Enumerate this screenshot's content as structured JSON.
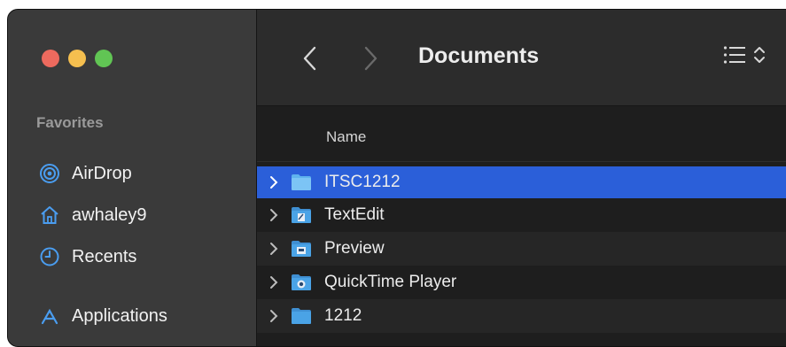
{
  "sidebar": {
    "section_heading": "Favorites",
    "items": [
      {
        "label": "AirDrop",
        "icon": "airdrop-icon"
      },
      {
        "label": "awhaley9",
        "icon": "home-icon"
      },
      {
        "label": "Recents",
        "icon": "clock-icon"
      },
      {
        "label": "Applications",
        "icon": "applications-icon"
      }
    ]
  },
  "toolbar": {
    "title": "Documents",
    "back_icon": "chevron-left-icon",
    "forward_icon": "chevron-right-icon",
    "view_icon": "list-view-icon"
  },
  "list": {
    "column_name": "Name",
    "rows": [
      {
        "name": "ITSC1212",
        "icon": "folder-icon",
        "selected": true
      },
      {
        "name": "TextEdit",
        "icon": "textedit-folder-icon",
        "selected": false
      },
      {
        "name": "Preview",
        "icon": "preview-folder-icon",
        "selected": false
      },
      {
        "name": "QuickTime Player",
        "icon": "quicktime-folder-icon",
        "selected": false
      },
      {
        "name": "1212",
        "icon": "folder-icon",
        "selected": false
      }
    ]
  },
  "colors": {
    "accent": "#2b5fd9",
    "sidebar_bg": "#3a3a3a",
    "folder": "#4aa3e6"
  }
}
